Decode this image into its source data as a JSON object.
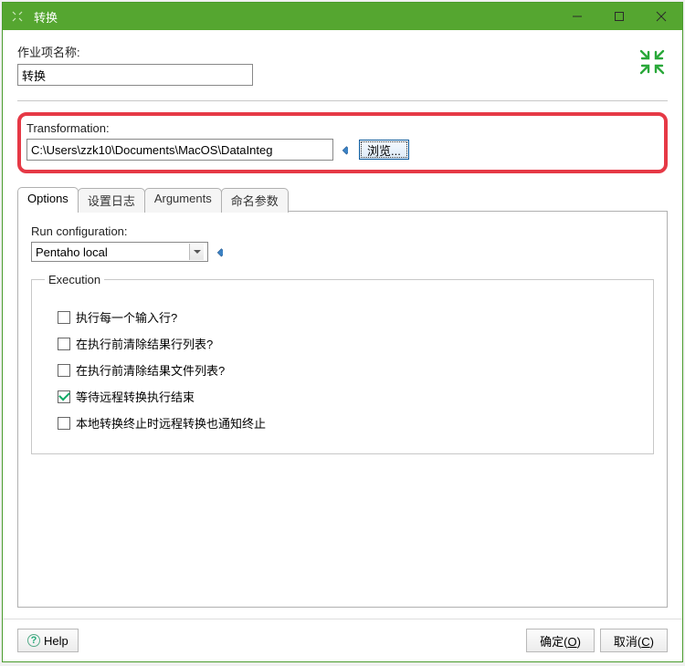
{
  "titlebar": {
    "title": "转换"
  },
  "job_name": {
    "label": "作业项名称:",
    "value": "转换"
  },
  "transformation": {
    "label": "Transformation:",
    "value": "C:\\Users\\zzk10\\Documents\\MacOS\\DataInteg",
    "browse_label": "浏览..."
  },
  "tabs": {
    "options": "Options",
    "log": "设置日志",
    "arguments": "Arguments",
    "named": "命名参数"
  },
  "options": {
    "run_config_label": "Run configuration:",
    "run_config_value": "Pentaho local",
    "execution_legend": "Execution",
    "checks": [
      {
        "label": "执行每一个输入行?",
        "checked": false
      },
      {
        "label": "在执行前清除结果行列表?",
        "checked": false
      },
      {
        "label": "在执行前清除结果文件列表?",
        "checked": false
      },
      {
        "label": "等待远程转换执行结束",
        "checked": true
      },
      {
        "label": "本地转换终止时远程转换也通知终止",
        "checked": false
      }
    ]
  },
  "footer": {
    "help": "Help",
    "ok": "确定(",
    "ok_u": "O",
    "ok_after": ")",
    "cancel": "取消(",
    "cancel_u": "C",
    "cancel_after": ")"
  }
}
